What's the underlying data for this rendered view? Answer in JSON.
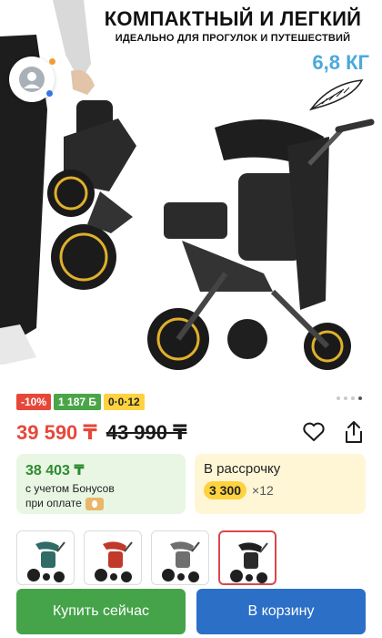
{
  "hero": {
    "title": "КОМПАКТНЫЙ И ЛЕГКИЙ",
    "subtitle": "ИДЕАЛЬНО ДЛЯ ПРОГУЛОК И ПУТЕШЕСТВИЙ",
    "weight": "6,8 КГ"
  },
  "badges": {
    "discount": "-10%",
    "bonus": "1 187 Б",
    "installment": "0·0·12"
  },
  "gallery": {
    "dots_count": 4,
    "active_index": 3
  },
  "price": {
    "current": "39 590 ₸",
    "old": "43 990 ₸"
  },
  "bonus_card": {
    "price": "38 403 ₸",
    "line1": "с учетом Бонусов",
    "line2": "при оплате"
  },
  "installment_card": {
    "title": "В рассрочку",
    "amount": "3 300",
    "multiplier": "×12"
  },
  "variants": [
    {
      "color": "teal",
      "accent": "#2f6b67"
    },
    {
      "color": "red",
      "accent": "#c0392b"
    },
    {
      "color": "grey",
      "accent": "#6f6f6f"
    },
    {
      "color": "black",
      "accent": "#1f1f1f"
    }
  ],
  "buttons": {
    "buy_now": "Купить сейчас",
    "add_to_cart": "В корзину"
  },
  "colors": {
    "discount_red": "#e7473a",
    "bonus_green": "#4aa548",
    "installment_yellow": "#ffd23f",
    "buy_button": "#45a34a",
    "cart_button": "#2c6fc7"
  }
}
